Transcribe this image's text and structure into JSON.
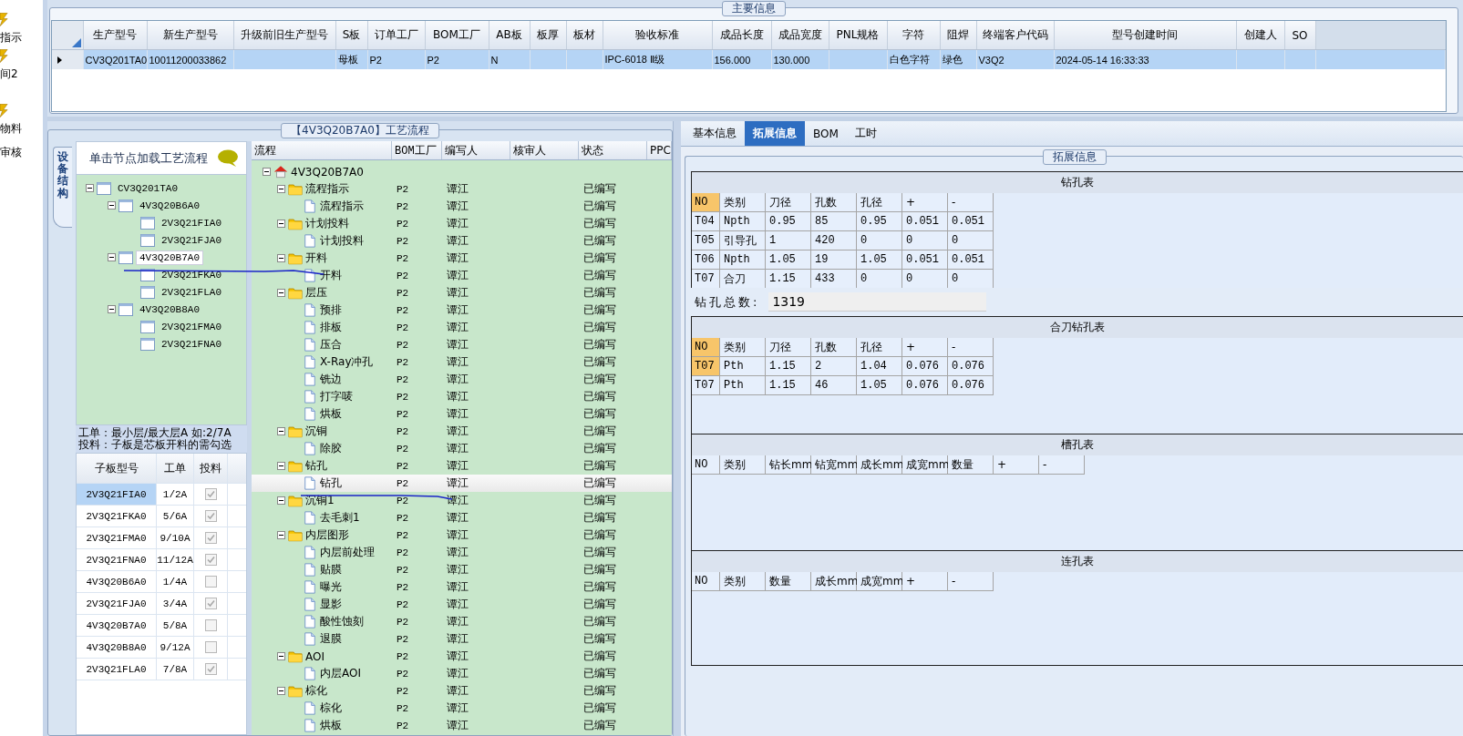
{
  "sidebar": {
    "items": [
      {
        "label": "指示",
        "icon": true
      },
      {
        "label": "间2",
        "icon": true
      },
      {
        "label": "物料",
        "icon": true
      },
      {
        "label": "审核",
        "icon": false
      }
    ]
  },
  "main_info": {
    "title": "主要信息",
    "columns": [
      "生产型号",
      "新生产型号",
      "升级前旧生产型号",
      "S板",
      "订单工厂",
      "BOM工厂",
      "AB板",
      "板厚",
      "板材",
      "验收标准",
      "成品长度",
      "成品宽度",
      "PNL规格",
      "字符",
      "阻焊",
      "终端客户代码",
      "型号创建时间",
      "创建人",
      "SO"
    ],
    "rows": [
      {
        "selected": true,
        "cells": [
          "CV3Q201TA0",
          "10011200033862",
          null,
          "母板",
          "P2",
          "P2",
          "N",
          null,
          null,
          "IPC-6018 Ⅱ级",
          "156.000",
          "130.000",
          null,
          "白色字符",
          "绿色",
          "V3Q2",
          "2024-05-14 16:33:33",
          null,
          null
        ]
      }
    ]
  },
  "process_panel": {
    "title": "【4V3Q20B7A0】工艺流程"
  },
  "structure": {
    "tab": "设备结构",
    "hint": "单击节点加载工艺流程",
    "tree": [
      {
        "name": "CV3Q201TA0",
        "expanded": true,
        "selected": false,
        "children": [
          {
            "name": "4V3Q20B6A0",
            "expanded": true,
            "selected": false,
            "children": [
              {
                "name": "2V3Q21FIA0",
                "selected": false
              },
              {
                "name": "2V3Q21FJA0",
                "selected": false
              }
            ]
          },
          {
            "name": "4V3Q20B7A0",
            "expanded": true,
            "selected": true,
            "children": [
              {
                "name": "2V3Q21FKA0",
                "selected": false
              },
              {
                "name": "2V3Q21FLA0",
                "selected": false
              }
            ]
          },
          {
            "name": "4V3Q20B8A0",
            "expanded": true,
            "selected": false,
            "children": [
              {
                "name": "2V3Q21FMA0",
                "selected": false
              },
              {
                "name": "2V3Q21FNA0",
                "selected": false
              }
            ]
          }
        ]
      }
    ],
    "notes": [
      "工单：最小层/最大层A 如:2/7A",
      "投料：子板是芯板开料的需勾选"
    ],
    "sub_boards": {
      "columns": [
        "子板型号",
        "工单",
        "投料"
      ],
      "rows": [
        {
          "model": "2V3Q21FIA0",
          "order": "1/2A",
          "feed": true,
          "selected": true
        },
        {
          "model": "2V3Q21FKA0",
          "order": "5/6A",
          "feed": true,
          "selected": false
        },
        {
          "model": "2V3Q21FMA0",
          "order": "9/10A",
          "feed": true,
          "selected": false
        },
        {
          "model": "2V3Q21FNA0",
          "order": "11/12A",
          "feed": true,
          "selected": false
        },
        {
          "model": "4V3Q20B6A0",
          "order": "1/4A",
          "feed": false,
          "selected": false
        },
        {
          "model": "2V3Q21FJA0",
          "order": "3/4A",
          "feed": true,
          "selected": false
        },
        {
          "model": "4V3Q20B7A0",
          "order": "5/8A",
          "feed": false,
          "selected": false
        },
        {
          "model": "4V3Q20B8A0",
          "order": "9/12A",
          "feed": false,
          "selected": false
        },
        {
          "model": "2V3Q21FLA0",
          "order": "7/8A",
          "feed": true,
          "selected": false
        }
      ]
    }
  },
  "process_flow": {
    "columns": [
      "流程",
      "BOM工厂",
      "编写人",
      "核审人",
      "状态",
      "PPC"
    ],
    "root": {
      "name": "4V3Q20B7A0",
      "kind": "root",
      "expanded": true,
      "selected": false,
      "children": [
        {
          "name": "流程指示",
          "kind": "folder",
          "expanded": true,
          "selected": false,
          "bom": "P2",
          "author": "谭江",
          "status": "已编写",
          "children": [
            {
              "name": "流程指示",
              "kind": "step",
              "selected": false,
              "bom": "P2",
              "author": "谭江",
              "status": "已编写"
            }
          ]
        },
        {
          "name": "计划投料",
          "kind": "folder",
          "expanded": true,
          "selected": false,
          "bom": "P2",
          "author": "谭江",
          "status": "已编写",
          "children": [
            {
              "name": "计划投料",
              "kind": "step",
              "selected": false,
              "bom": "P2",
              "author": "谭江",
              "status": "已编写"
            }
          ]
        },
        {
          "name": "开料",
          "kind": "folder",
          "expanded": true,
          "selected": false,
          "bom": "P2",
          "author": "谭江",
          "status": "已编写",
          "children": [
            {
              "name": "开料",
              "kind": "step",
              "selected": false,
              "bom": "P2",
              "author": "谭江",
              "status": "已编写"
            }
          ]
        },
        {
          "name": "层压",
          "kind": "folder",
          "expanded": true,
          "selected": false,
          "bom": "P2",
          "author": "谭江",
          "status": "已编写",
          "children": [
            {
              "name": "预排",
              "kind": "step",
              "selected": false,
              "bom": "P2",
              "author": "谭江",
              "status": "已编写"
            },
            {
              "name": "排板",
              "kind": "step",
              "selected": false,
              "bom": "P2",
              "author": "谭江",
              "status": "已编写"
            },
            {
              "name": "压合",
              "kind": "step",
              "selected": false,
              "bom": "P2",
              "author": "谭江",
              "status": "已编写"
            },
            {
              "name": "X-Ray冲孔",
              "kind": "step",
              "selected": false,
              "bom": "P2",
              "author": "谭江",
              "status": "已编写"
            },
            {
              "name": "铣边",
              "kind": "step",
              "selected": false,
              "bom": "P2",
              "author": "谭江",
              "status": "已编写"
            },
            {
              "name": "打字唛",
              "kind": "step",
              "selected": false,
              "bom": "P2",
              "author": "谭江",
              "status": "已编写"
            },
            {
              "name": "烘板",
              "kind": "step",
              "selected": false,
              "bom": "P2",
              "author": "谭江",
              "status": "已编写"
            }
          ]
        },
        {
          "name": "沉铜",
          "kind": "folder",
          "expanded": true,
          "selected": false,
          "bom": "P2",
          "author": "谭江",
          "status": "已编写",
          "children": [
            {
              "name": "除胶",
              "kind": "step",
              "selected": false,
              "bom": "P2",
              "author": "谭江",
              "status": "已编写"
            }
          ]
        },
        {
          "name": "钻孔",
          "kind": "folder",
          "expanded": true,
          "selected": false,
          "bom": "P2",
          "author": "谭江",
          "status": "已编写",
          "children": [
            {
              "name": "钻孔",
              "kind": "step",
              "selected": true,
              "bom": "P2",
              "author": "谭江",
              "status": "已编写"
            }
          ]
        },
        {
          "name": "沉铜1",
          "kind": "folder",
          "expanded": true,
          "selected": false,
          "bom": "P2",
          "author": "谭江",
          "status": "已编写",
          "children": [
            {
              "name": "去毛刺1",
              "kind": "step",
              "selected": false,
              "bom": "P2",
              "author": "谭江",
              "status": "已编写"
            }
          ]
        },
        {
          "name": "内层图形",
          "kind": "folder",
          "expanded": true,
          "selected": false,
          "bom": "P2",
          "author": "谭江",
          "status": "已编写",
          "children": [
            {
              "name": "内层前处理",
              "kind": "step",
              "selected": false,
              "bom": "P2",
              "author": "谭江",
              "status": "已编写"
            },
            {
              "name": "贴膜",
              "kind": "step",
              "selected": false,
              "bom": "P2",
              "author": "谭江",
              "status": "已编写"
            },
            {
              "name": "曝光",
              "kind": "step",
              "selected": false,
              "bom": "P2",
              "author": "谭江",
              "status": "已编写"
            },
            {
              "name": "显影",
              "kind": "step",
              "selected": false,
              "bom": "P2",
              "author": "谭江",
              "status": "已编写"
            },
            {
              "name": "酸性蚀刻",
              "kind": "step",
              "selected": false,
              "bom": "P2",
              "author": "谭江",
              "status": "已编写"
            },
            {
              "name": "退膜",
              "kind": "step",
              "selected": false,
              "bom": "P2",
              "author": "谭江",
              "status": "已编写"
            }
          ]
        },
        {
          "name": "AOI",
          "kind": "folder",
          "expanded": true,
          "selected": false,
          "bom": "P2",
          "author": "谭江",
          "status": "已编写",
          "children": [
            {
              "name": "内层AOI",
              "kind": "step",
              "selected": false,
              "bom": "P2",
              "author": "谭江",
              "status": "已编写"
            }
          ]
        },
        {
          "name": "棕化",
          "kind": "folder",
          "expanded": true,
          "selected": false,
          "bom": "P2",
          "author": "谭江",
          "status": "已编写",
          "children": [
            {
              "name": "棕化",
              "kind": "step",
              "selected": false,
              "bom": "P2",
              "author": "谭江",
              "status": "已编写"
            },
            {
              "name": "烘板",
              "kind": "step",
              "selected": false,
              "bom": "P2",
              "author": "谭江",
              "status": "已编写"
            }
          ]
        }
      ]
    }
  },
  "detail": {
    "tabs": [
      {
        "label": "基本信息",
        "selected": false
      },
      {
        "label": "拓展信息",
        "selected": true
      },
      {
        "label": "BOM",
        "selected": false
      },
      {
        "label": "工时",
        "selected": false
      }
    ],
    "group_title": "拓展信息",
    "tables": [
      {
        "title": "钻孔表",
        "header_highlight": true,
        "columns": [
          "NO",
          "类别",
          "刀径",
          "孔数",
          "孔径",
          "+",
          "-"
        ],
        "rows": [
          {
            "current": false,
            "cells": [
              "T04",
              "Npth",
              "0.95",
              "85",
              "0.95",
              "0.051",
              "0.051"
            ]
          },
          {
            "current": false,
            "cells": [
              "T05",
              "引导孔",
              "1",
              "420",
              "0",
              "0",
              "0"
            ]
          },
          {
            "current": false,
            "cells": [
              "T06",
              "Npth",
              "1.05",
              "19",
              "1.05",
              "0.051",
              "0.051"
            ]
          },
          {
            "current": false,
            "cells": [
              "T07",
              "合刀",
              "1.15",
              "433",
              "0",
              "0",
              "0"
            ]
          }
        ],
        "total": {
          "label": "钻孔总数:",
          "value": "1319"
        }
      },
      {
        "title": "合刀钻孔表",
        "header_highlight": true,
        "columns": [
          "NO",
          "类别",
          "刀径",
          "孔数",
          "孔径",
          "+",
          "-"
        ],
        "rows": [
          {
            "current": true,
            "cells": [
              "T07",
              "Pth",
              "1.15",
              "2",
              "1.04",
              "0.076",
              "0.076"
            ]
          },
          {
            "current": false,
            "cells": [
              "T07",
              "Pth",
              "1.15",
              "46",
              "1.05",
              "0.076",
              "0.076"
            ]
          }
        ]
      },
      {
        "title": "槽孔表",
        "header_highlight": false,
        "columns": [
          "NO",
          "类别",
          "钻长mm",
          "钻宽mm",
          "成长mm",
          "成宽mm",
          "数量",
          "+",
          "-"
        ]
      },
      {
        "title": "连孔表",
        "header_highlight": false,
        "columns": [
          "NO",
          "类别",
          "数量",
          "成长mm",
          "成宽mm",
          "+",
          "-"
        ]
      }
    ]
  }
}
